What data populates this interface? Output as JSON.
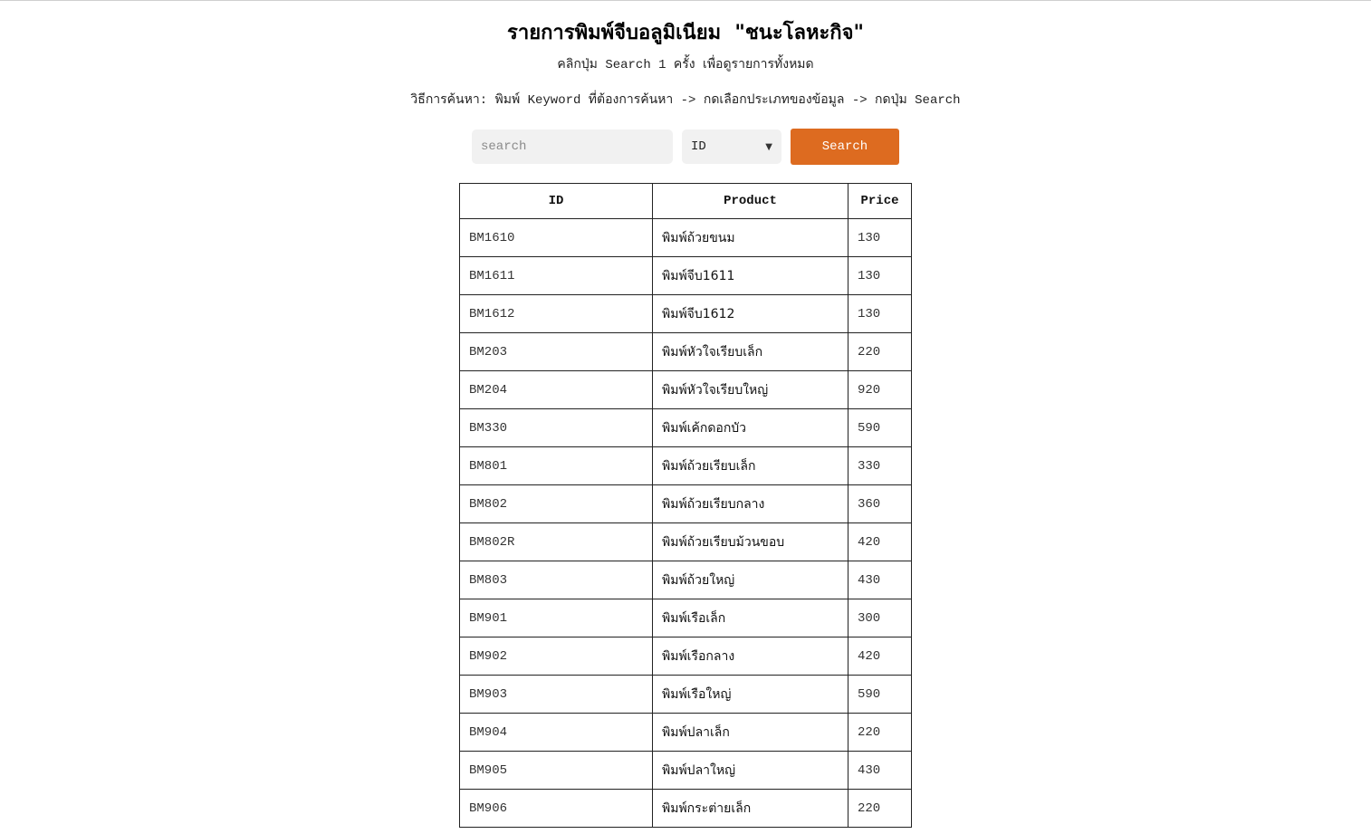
{
  "header": {
    "title": "รายการพิมพ์จีบอลูมิเนียม  \"ชนะโลหะกิจ\"",
    "hint_line_1": "คลิกปุ่ม Search 1 ครั้ง เพื่อดูรายการทั้งหมด",
    "hint_line_2": "วิธีการค้นหา: พิมพ์ Keyword ที่ต้องการค้นหา -> กดเลือกประเภทของข้อมูล -> กดปุ่ม Search"
  },
  "search": {
    "placeholder": "search",
    "value": "",
    "filter_selected": "ID",
    "button_label": "Search"
  },
  "colors": {
    "accent": "#dd6b20",
    "input_bg": "#f1f1f1",
    "border": "#222222"
  },
  "table": {
    "headers": [
      "ID",
      "Product",
      "Price"
    ],
    "rows": [
      {
        "id": "BM1610",
        "product": "พิมพ์ถ้วยขนม",
        "price": "130"
      },
      {
        "id": "BM1611",
        "product": "พิมพ์จีบ1611",
        "price": "130"
      },
      {
        "id": "BM1612",
        "product": "พิมพ์จีบ1612",
        "price": "130"
      },
      {
        "id": "BM203",
        "product": "พิมพ์หัวใจเรียบเล็ก",
        "price": "220"
      },
      {
        "id": "BM204",
        "product": "พิมพ์หัวใจเรียบใหญ่",
        "price": "920"
      },
      {
        "id": "BM330",
        "product": "พิมพ์เค้กดอกบัว",
        "price": "590"
      },
      {
        "id": "BM801",
        "product": "พิมพ์ถ้วยเรียบเล็ก",
        "price": "330"
      },
      {
        "id": "BM802",
        "product": "พิมพ์ถ้วยเรียบกลาง",
        "price": "360"
      },
      {
        "id": "BM802R",
        "product": "พิมพ์ถ้วยเรียบม้วนขอบ",
        "price": "420"
      },
      {
        "id": "BM803",
        "product": "พิมพ์ถ้วยใหญ่",
        "price": "430"
      },
      {
        "id": "BM901",
        "product": "พิมพ์เรือเล็ก",
        "price": "300"
      },
      {
        "id": "BM902",
        "product": "พิมพ์เรือกลาง",
        "price": "420"
      },
      {
        "id": "BM903",
        "product": "พิมพ์เรือใหญ่",
        "price": "590"
      },
      {
        "id": "BM904",
        "product": "พิมพ์ปลาเล็ก",
        "price": "220"
      },
      {
        "id": "BM905",
        "product": "พิมพ์ปลาใหญ่",
        "price": "430"
      },
      {
        "id": "BM906",
        "product": "พิมพ์กระต่ายเล็ก",
        "price": "220"
      }
    ]
  }
}
